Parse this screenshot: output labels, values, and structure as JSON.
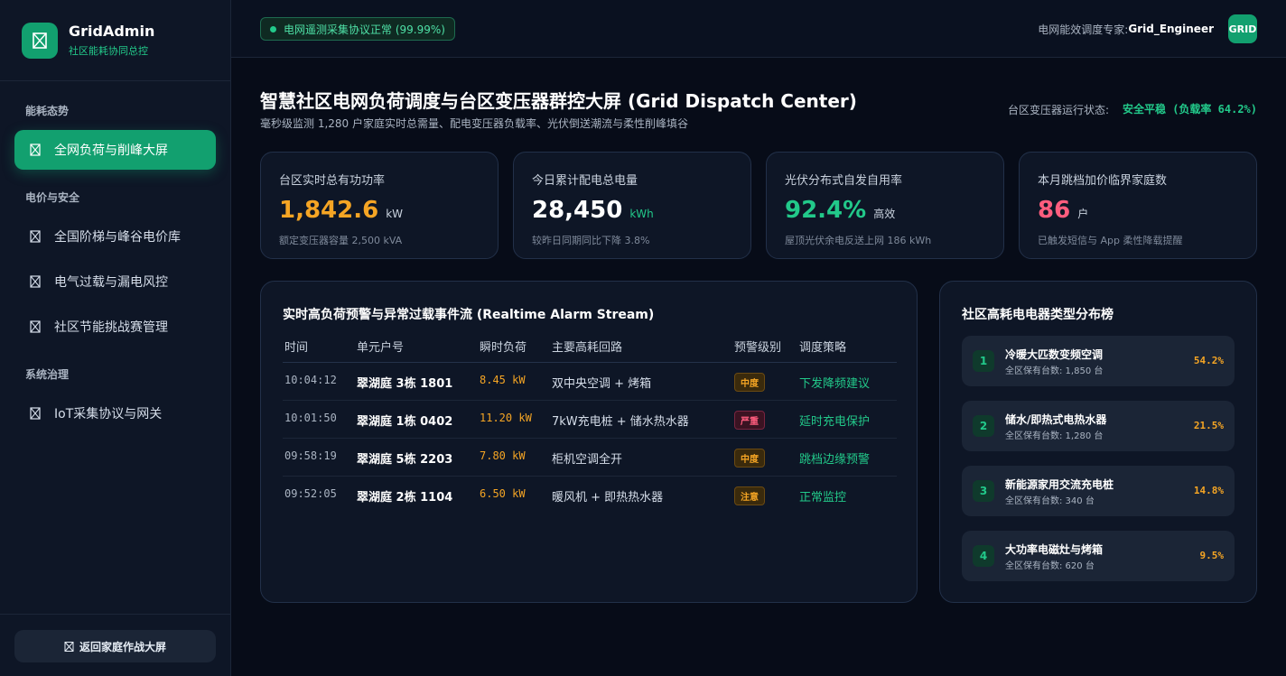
{
  "brand": {
    "name": "GridAdmin",
    "subtitle": "社区能耗协同总控"
  },
  "sidebar": {
    "sections": [
      "能耗态势",
      "电价与安全",
      "系统治理"
    ],
    "items": [
      {
        "label": "全网负荷与削峰大屏",
        "active": true
      },
      {
        "label": "全国阶梯与峰谷电价库"
      },
      {
        "label": "电气过载与漏电风控"
      },
      {
        "label": "社区节能挑战赛管理"
      },
      {
        "label": "IoT采集协议与网关"
      }
    ],
    "back_button": "返回家庭作战大屏"
  },
  "topbar": {
    "status": "电网遥测采集协议正常 (99.99%)",
    "user_role": "电网能效调度专家:",
    "user_name": "Grid_Engineer",
    "avatar": "GRID"
  },
  "header": {
    "title": "智慧社区电网负荷调度与台区变压器群控大屏 (Grid Dispatch Center)",
    "subtitle": "毫秒级监测 1,280 户家庭实时总需量、配电变压器负载率、光伏倒送潮流与柔性削峰填谷",
    "state_label": "台区变压器运行状态:",
    "state_value": "安全平稳 (负载率 64.2%)"
  },
  "kpis": [
    {
      "label": "台区实时总有功功率",
      "value": "1,842.6",
      "unit": "kW",
      "note": "额定变压器容量 2,500 kVA",
      "color": "#f5a524",
      "unit_color": "#c9d2de"
    },
    {
      "label": "今日累计配电总电量",
      "value": "28,450",
      "unit": "kWh",
      "note": "较昨日同期同比下降 3.8%",
      "color": "#ffffff",
      "unit_color": "#22c98a"
    },
    {
      "label": "光伏分布式自发自用率",
      "value": "92.4%",
      "unit": "高效",
      "note": "屋顶光伏余电反送上网 186 kWh",
      "color": "#22c98a",
      "unit_color": "#c9d2de"
    },
    {
      "label": "本月跳档加价临界家庭数",
      "value": "86",
      "unit": "户",
      "note": "已触发短信与 App 柔性降载提醒",
      "color": "#ff5d7e",
      "unit_color": "#c9d2de"
    }
  ],
  "alarm": {
    "title": "实时高负荷预警与异常过载事件流 (Realtime Alarm Stream)",
    "columns": [
      "时间",
      "单元户号",
      "瞬时负荷",
      "主要高耗回路",
      "预警级别",
      "调度策略"
    ],
    "rows": [
      {
        "time": "10:04:12",
        "unit": "翠湖庭 3栋 1801",
        "load": "8.45 kW",
        "circuit": "双中央空调 + 烤箱",
        "level": "中度",
        "level_type": "mid",
        "action": "下发降频建议"
      },
      {
        "time": "10:01:50",
        "unit": "翠湖庭 1栋 0402",
        "load": "11.20 kW",
        "circuit": "7kW充电桩 + 储水热水器",
        "level": "严重",
        "level_type": "high",
        "action": "延时充电保护"
      },
      {
        "time": "09:58:19",
        "unit": "翠湖庭 5栋 2203",
        "load": "7.80 kW",
        "circuit": "柜机空调全开",
        "level": "中度",
        "level_type": "mid",
        "action": "跳档边缘预警"
      },
      {
        "time": "09:52:05",
        "unit": "翠湖庭 2栋 1104",
        "load": "6.50 kW",
        "circuit": "暖风机 + 即热热水器",
        "level": "注意",
        "level_type": "low",
        "action": "正常监控"
      }
    ]
  },
  "ranking": {
    "title": "社区高耗电电器类型分布榜",
    "items": [
      {
        "rank": "1",
        "name": "冷暖大匹数变频空调",
        "count": "全区保有台数: 1,850 台",
        "pct": "54.2%"
      },
      {
        "rank": "2",
        "name": "储水/即热式电热水器",
        "count": "全区保有台数: 1,280 台",
        "pct": "21.5%"
      },
      {
        "rank": "3",
        "name": "新能源家用交流充电桩",
        "count": "全区保有台数: 340 台",
        "pct": "14.8%"
      },
      {
        "rank": "4",
        "name": "大功率电磁灶与烤箱",
        "count": "全区保有台数: 620 台",
        "pct": "9.5%"
      }
    ]
  }
}
